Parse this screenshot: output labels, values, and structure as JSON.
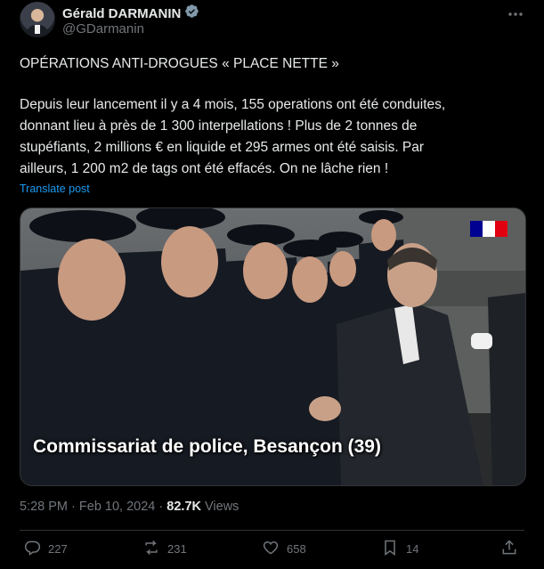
{
  "author": {
    "name": "Gérald DARMANIN",
    "handle": "@GDarmanin",
    "verified": true,
    "avatar_icon": "avatar-portrait"
  },
  "tweet": {
    "title": "OPÉRATIONS ANTI-DROGUES « PLACE NETTE »",
    "body": "Depuis leur lancement il y a 4 mois, 155 operations ont été conduites,\ndonnant lieu à près de 1 300 interpellations ! Plus de 2 tonnes de\nstupéfiants, 2 millions € en liquide et 295 armes ont été saisis. Par\nailleurs, 1 200 m2 de tags ont été effacés. On ne lâche rien !",
    "translate_label": "Translate post"
  },
  "media": {
    "caption": "Commissariat de police, Besançon (39)",
    "flag_colors": [
      "#000091",
      "#ffffff",
      "#e1000f"
    ]
  },
  "meta": {
    "time": "5:28 PM",
    "separator": "·",
    "date": "Feb 10, 2024",
    "views_count": "82.7K",
    "views_label": "Views"
  },
  "actions": {
    "replies": "227",
    "reposts": "231",
    "likes": "658",
    "bookmarks": "14"
  },
  "colors": {
    "background": "#000000",
    "text": "#e7e9ea",
    "muted": "#71767b",
    "link": "#1d9bf0",
    "verified": "#829aab"
  }
}
